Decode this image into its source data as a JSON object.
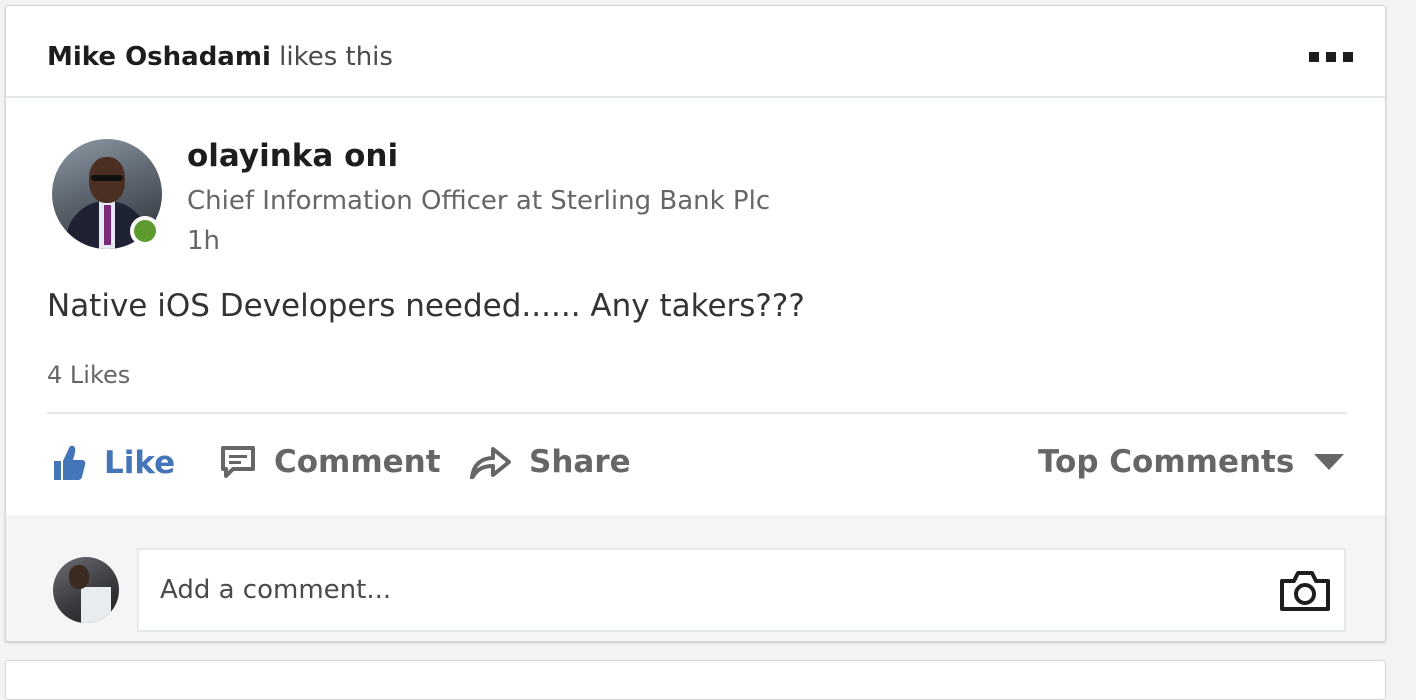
{
  "social_header": {
    "actor": "Mike Oshadami",
    "action": " likes this"
  },
  "post": {
    "author_name": "olayinka oni",
    "author_headline": "Chief Information Officer at Sterling Bank Plc",
    "time": "1h",
    "text": "Native iOS Developers needed...... Any takers???",
    "likes": "4 Likes"
  },
  "actions": {
    "like": "Like",
    "comment": "Comment",
    "share": "Share",
    "sort": "Top Comments"
  },
  "comment_box": {
    "placeholder": "Add a comment..."
  },
  "colors": {
    "like_blue": "#4575b9",
    "presence_green": "#5e9b2f",
    "muted_text": "#666666"
  },
  "icons": [
    "more-icon",
    "presence-icon",
    "like-icon",
    "comment-icon",
    "share-icon",
    "caret-down-icon",
    "camera-icon"
  ]
}
